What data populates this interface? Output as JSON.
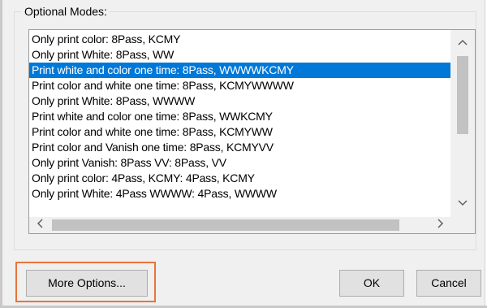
{
  "group_label": "Optional Modes:",
  "modes": [
    "Only print color: 8Pass, KCMY",
    "Only print White: 8Pass, WW",
    "Print white and color one time: 8Pass, WWWWKCMY",
    "Print color and white one time: 8Pass, KCMYWWWW",
    "Only print White: 8Pass, WWWW",
    "Print white and color one time: 8Pass, WWKCMY",
    "Print color and white one time: 8Pass, KCMYWW",
    "Print color and Vanish one time: 8Pass, KCMYVV",
    "Only print Vanish: 8Pass VV: 8Pass, VV",
    "Only print color: 4Pass, KCMY: 4Pass, KCMY",
    "Only print White: 4Pass WWWW: 4Pass, WWWW"
  ],
  "selected_index": 2,
  "scroll_icons": {
    "up": "chevron-up-icon",
    "down": "chevron-down-icon",
    "left": "chevron-left-icon",
    "right": "chevron-right-icon"
  },
  "buttons": {
    "more_options": "More Options...",
    "ok": "OK",
    "cancel": "Cancel"
  },
  "colors": {
    "selection": "#0078d7",
    "highlight_box": "#e8743c"
  }
}
